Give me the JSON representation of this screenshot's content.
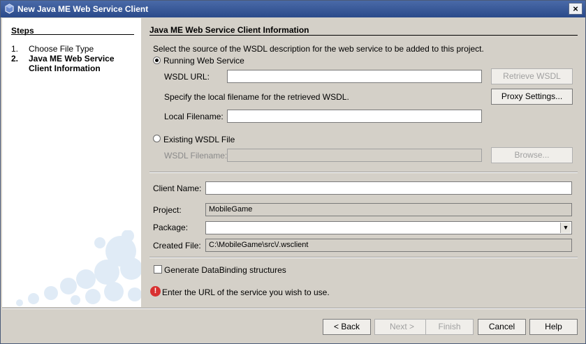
{
  "window": {
    "title": "New Java ME Web Service Client",
    "close_glyph": "×"
  },
  "steps": {
    "heading": "Steps",
    "items": [
      {
        "num": "1.",
        "label": "Choose File Type"
      },
      {
        "num": "2.",
        "label": "Java ME Web Service Client Information"
      }
    ]
  },
  "panel": {
    "title": "Java ME Web Service Client Information",
    "instruction": "Select the source of the WSDL description for the web service to be added to this project.",
    "running_radio_label": "Running Web Service",
    "wsdl_url_label": "WSDL URL:",
    "wsdl_url_value": "",
    "retrieve_button": "Retrieve WSDL",
    "specify_text": "Specify the local filename for the retrieved WSDL.",
    "proxy_button": "Proxy Settings...",
    "local_filename_label": "Local Filename:",
    "local_filename_value": "",
    "existing_radio_label": "Existing WSDL File",
    "wsdl_filename_label": "WSDL Filename:",
    "wsdl_filename_value": "",
    "browse_button": "Browse...",
    "client_name_label": "Client Name:",
    "client_name_value": "",
    "project_label": "Project:",
    "project_value": "MobileGame",
    "package_label": "Package:",
    "package_value": "",
    "created_file_label": "Created File:",
    "created_file_value": "C:\\MobileGame\\src\\/.wsclient",
    "databinding_label": "Generate DataBinding structures",
    "error_message": "Enter the URL of the service you wish to use."
  },
  "footer": {
    "back": "< Back",
    "next": "Next >",
    "finish": "Finish",
    "cancel": "Cancel",
    "help": "Help"
  },
  "icons": {
    "app": "java-cup-icon",
    "error": "error-icon",
    "close": "close-icon",
    "dropdown": "chevron-down-icon"
  },
  "colors": {
    "titlebar": "#3a5a98",
    "dialog_bg": "#d4d0c8",
    "error": "#d83030"
  }
}
